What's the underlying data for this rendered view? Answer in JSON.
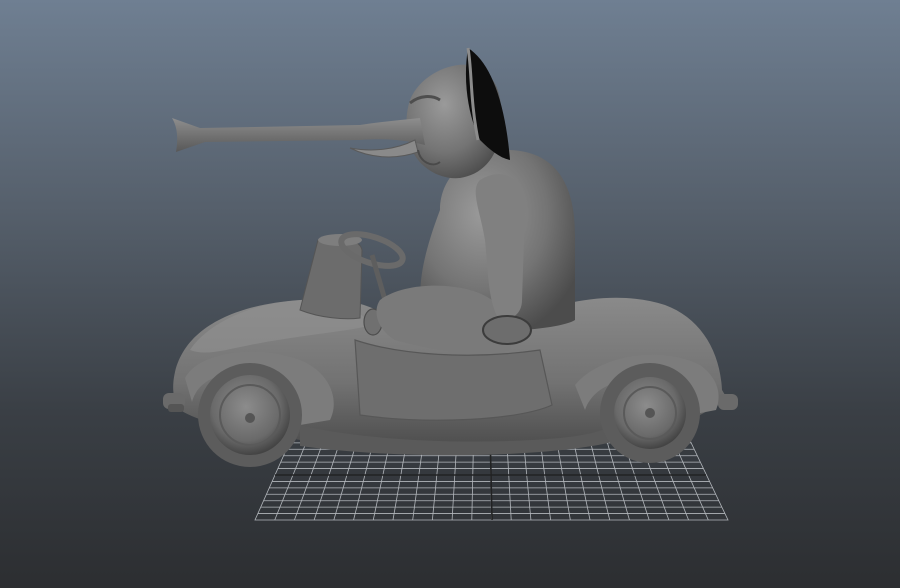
{
  "viewport": {
    "background_top": "#6f7f92",
    "background_bottom": "#2c2e31",
    "grid_color": "#c9cdd2",
    "model_fill": "#747474",
    "model_shadow": "#4c4c4c",
    "model_highlight": "#9a9a9a",
    "ear_inner": "#0d0d0d"
  },
  "scene": {
    "subject": "elephant-driving-car-model",
    "shading": "grey-default-material",
    "ground": "perspective-grid"
  }
}
